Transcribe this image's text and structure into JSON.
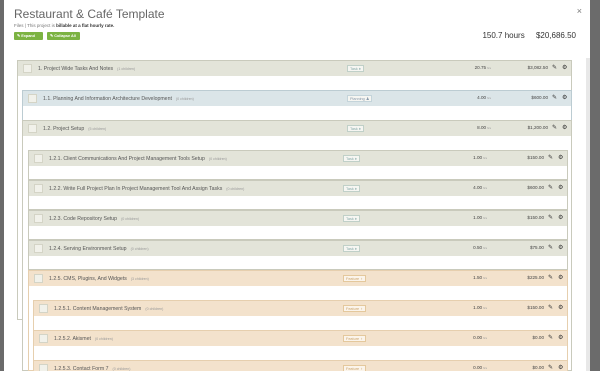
{
  "header": {
    "title": "Restaurant & Café Template",
    "subtitle_prefix": "Files | This project is",
    "subtitle_bold": "billable at a flat hourly rate.",
    "close_label": "×",
    "expand_all_label": "✎ Expand All",
    "collapse_all_label": "✎ Collapse All",
    "total_hours": "150.7 hours",
    "total_cost": "$20,686.50"
  },
  "rows": [
    {
      "name": "1. Project Wide Tasks And Notes",
      "children": "(1 children)",
      "type": "Task",
      "hours": "20.75",
      "hours_unit": "hrs",
      "cost": "$3,082.50"
    },
    {
      "name": "1.1. Planning And Information Architecture Development",
      "children": "(0 children)",
      "type": "Planning",
      "hours": "4.00",
      "hours_unit": "hrs",
      "cost": "$600.00"
    },
    {
      "name": "1.2. Project Setup",
      "children": "(5 children)",
      "type": "Task",
      "hours": "8.00",
      "hours_unit": "hrs",
      "cost": "$1,200.00"
    },
    {
      "name": "1.2.1. Client Communications And Project Management Tools Setup",
      "children": "(0 children)",
      "type": "Task",
      "hours": "1.00",
      "hours_unit": "hrs",
      "cost": "$150.00"
    },
    {
      "name": "1.2.2. Write Full Project Plan In Project Management Tool And Assign Tasks",
      "children": "(0 children)",
      "type": "Task",
      "hours": "4.00",
      "hours_unit": "hrs",
      "cost": "$600.00"
    },
    {
      "name": "1.2.3. Code Repository Setup",
      "children": "(0 children)",
      "type": "Task",
      "hours": "1.00",
      "hours_unit": "hrs",
      "cost": "$150.00"
    },
    {
      "name": "1.2.4. Serving Environment Setup",
      "children": "(0 children)",
      "type": "Task",
      "hours": "0.50",
      "hours_unit": "hrs",
      "cost": "$75.00"
    },
    {
      "name": "1.2.5. CMS, Plugins, And Widgets",
      "children": "(3 children)",
      "type": "Feature",
      "hours": "1.50",
      "hours_unit": "hrs",
      "cost": "$225.00"
    },
    {
      "name": "1.2.5.1. Content Management System",
      "children": "(0 children)",
      "type": "Feature",
      "hours": "1.00",
      "hours_unit": "hrs",
      "cost": "$150.00"
    },
    {
      "name": "1.2.5.2. Akismet",
      "children": "(0 children)",
      "type": "Feature",
      "hours": "0.00",
      "hours_unit": "hrs",
      "cost": "$0.00"
    },
    {
      "name": "1.2.5.3. Contact Form 7",
      "children": "(0 children)",
      "type": "Feature",
      "hours": "0.00",
      "hours_unit": "hrs",
      "cost": "$0.00"
    }
  ],
  "icons": {
    "edit": "✎",
    "settings": "⚙",
    "task_type": "♦",
    "planning_type": "♟",
    "feature_type": "♀"
  }
}
